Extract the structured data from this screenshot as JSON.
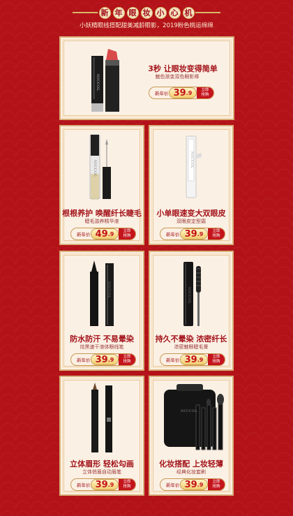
{
  "header": {
    "title_chars": [
      "新",
      "年",
      "眼",
      "妆",
      "小",
      "心",
      "机"
    ],
    "subtitle": "小妖精眼线搭配甜美减龄眼影，2019粉色桃运绵绵"
  },
  "brand_text": "NICCOL",
  "products": [
    {
      "name": "3秒 让眼妆变得简单",
      "desc": "魅色渐变双色眼影棒",
      "price_label": "新年价",
      "price_big": "39",
      "price_small": ".9",
      "buy": [
        "立即",
        "抢购"
      ]
    },
    {
      "name": "根根养护 唤醒纤长睫毛",
      "desc": "睫毛滋养精华液",
      "price_label": "新年价",
      "price_big": "49",
      "price_small": ".9",
      "buy": [
        "立即",
        "抢购"
      ]
    },
    {
      "name": "小单眼速变大双眼皮",
      "desc": "双眼皮定型霜",
      "price_label": "新年价",
      "price_big": "39",
      "price_small": ".9",
      "buy": [
        "立即",
        "抢购"
      ]
    },
    {
      "name": "防水防汗 不易晕染",
      "desc": "炫黑速干液体眼线笔",
      "price_label": "新年价",
      "price_big": "39",
      "price_small": ".9",
      "buy": [
        "立即",
        "抢购"
      ]
    },
    {
      "name": "持久不晕染 浓密纤长",
      "desc": "浓密魅眼睫毛膏",
      "price_label": "新年价",
      "price_big": "39",
      "price_small": ".9",
      "buy": [
        "立即",
        "抢购"
      ]
    },
    {
      "name": "立体眉形 轻松勾画",
      "desc": "立体俏眉自动眉笔",
      "price_label": "新年价",
      "price_big": "39",
      "price_small": ".9",
      "buy": [
        "立即",
        "抢购"
      ]
    },
    {
      "name": "化妆搭配 上妆轻薄",
      "desc": "经典化妆套刷",
      "price_label": "新年价",
      "price_big": "39",
      "price_small": ".9",
      "buy": [
        "立即",
        "抢购"
      ]
    }
  ]
}
